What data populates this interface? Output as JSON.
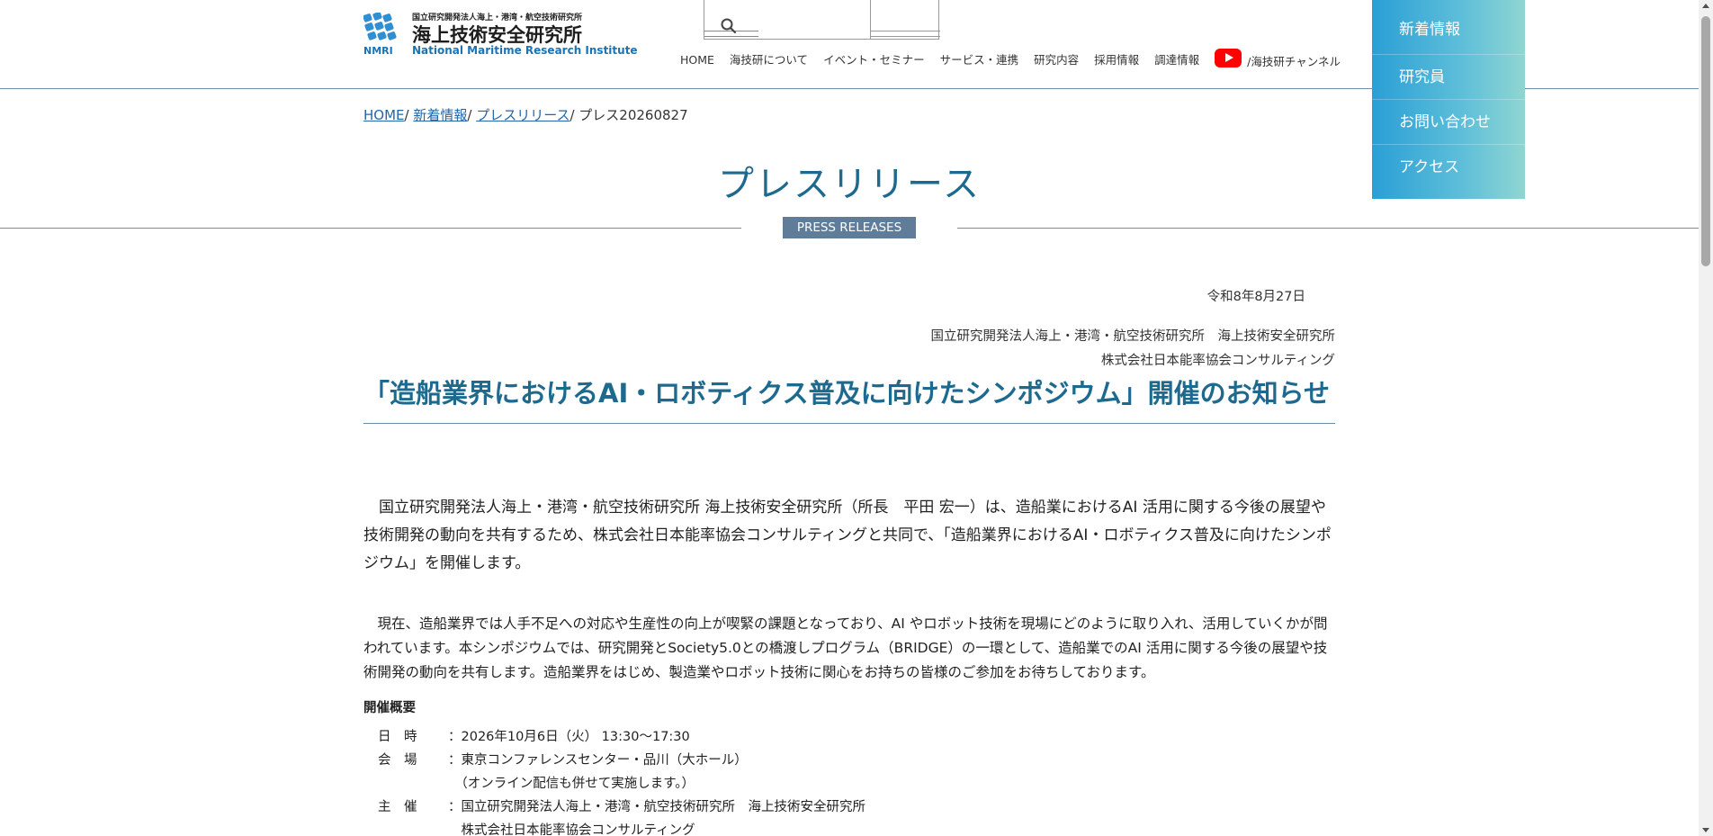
{
  "header": {
    "logo_small": "国立研究開発法人海上・港湾・航空技術研究所",
    "logo_big": "海上技術安全研究所",
    "logo_en": "National Maritime Research Institute",
    "logo_abbr": "NMRI"
  },
  "nav": {
    "items": [
      "HOME",
      "海技研について",
      "イベント・セミナー",
      "サービス・連携",
      "研究内容",
      "採用情報",
      "調達情報"
    ],
    "youtube_label": "/海技研チャンネル"
  },
  "side_menu": {
    "items": [
      "新着情報",
      "研究員",
      "お問い合わせ",
      "アクセス"
    ]
  },
  "breadcrumb": {
    "home": "HOME",
    "news": "新着情報",
    "press": "プレスリリース",
    "current": "プレス20260827",
    "sep": "/ "
  },
  "page": {
    "title": "プレスリリース",
    "badge": "PRESS RELEASES"
  },
  "article": {
    "date": "令和8年8月27日",
    "org1": "国立研究開発法人海上・港湾・航空技術研究所　海上技術安全研究所",
    "org2": "株式会社日本能率協会コンサルティング",
    "title": "「造船業界におけるAI・ロボティクス普及に向けたシンポジウム」開催のお知らせ",
    "para1": "　国立研究開発法人海上・港湾・航空技術研究所 海上技術安全研究所（所長　平田 宏一）は、造船業におけるAI 活用に関する今後の展望や技術開発の動向を共有するため、株式会社日本能率協会コンサルティングと共同で、「造船業界におけるAI・ロボティクス普及に向けたシンポジウム」を開催します。",
    "para2": "　現在、造船業界では人手不足への対応や生産性の向上が喫緊の課題となっており、AI やロボット技術を現場にどのように取り入れ、活用していくかが問われています。本シンポジウムでは、研究開発とSociety5.0との橋渡しプログラム（BRIDGE）の一環として、造船業でのAI 活用に関する今後の展望や技術開発の動向を共有します。造船業界をはじめ、製造業やロボット技術に関心をお持ちの皆様のご参加をお待ちしております。",
    "summary_head": "開催概要",
    "summary": [
      {
        "k": "日　時",
        "v": "：2026年10月6日（火） 13:30～17:30"
      },
      {
        "k": "会　場",
        "v": "：東京コンファレンスセンター・品川（大ホール）"
      },
      {
        "k": "",
        "v": "　（オンライン配信も併せて実施します。）"
      },
      {
        "k": "主　催",
        "v": "：国立研究開発法人海上・港湾・航空技術研究所　海上技術安全研究所"
      },
      {
        "k": "",
        "v": "　株式会社日本能率協会コンサルティング"
      }
    ]
  },
  "colors": {
    "accent": "#1e6a8f",
    "link": "#2366a8",
    "badge": "#5f7c99",
    "youtube": "#ff0000"
  }
}
